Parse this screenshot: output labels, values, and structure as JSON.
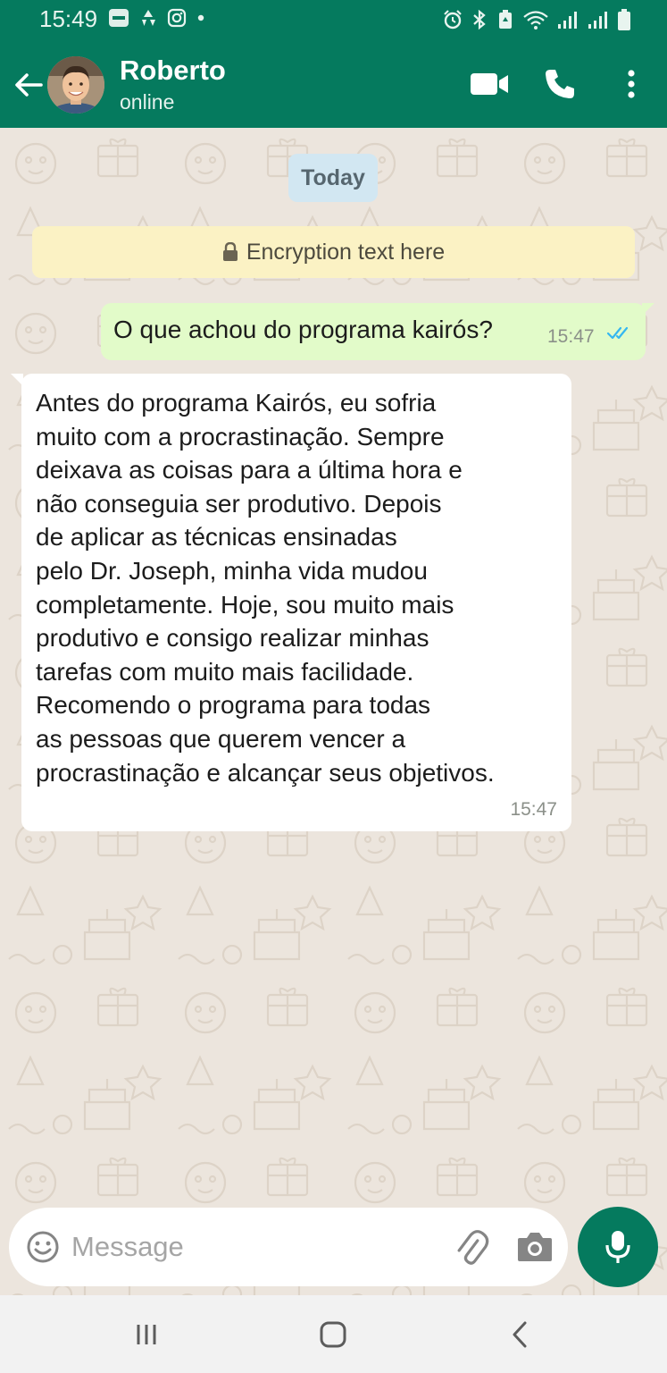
{
  "status_bar": {
    "time": "15:49",
    "left_icons": [
      "inter-app-icon",
      "recycle-icon",
      "instagram-icon",
      "dot-icon"
    ],
    "right_icons": [
      "alarm-icon",
      "bluetooth-icon",
      "battery-saver-icon",
      "wifi-icon",
      "signal-icon",
      "signal-icon",
      "battery-icon"
    ]
  },
  "header": {
    "contact_name": "Roberto",
    "contact_status": "online",
    "actions": [
      "video-call-icon",
      "phone-icon",
      "more-vert-icon"
    ]
  },
  "chat": {
    "date_chip": "Today",
    "encryption_text": "Encryption text here",
    "messages": [
      {
        "direction": "outgoing",
        "text": "O que achou do programa kairós?",
        "time": "15:47",
        "status": "read",
        "status_color": "#34b7f1"
      },
      {
        "direction": "incoming",
        "text": "Antes do programa Kairós, eu sofria\nmuito com a procrastinação. Sempre\ndeixava as coisas para a última hora e\nnão conseguia ser produtivo. Depois\nde aplicar as técnicas ensinadas\npelo Dr. Joseph, minha vida mudou\ncompletamente. Hoje, sou muito mais\nprodutivo e consigo realizar minhas\ntarefas com muito mais facilidade.\nRecomendo o programa para todas\nas pessoas que querem vencer a\nprocrastinação e alcançar seus objetivos.",
        "time": "15:47"
      }
    ]
  },
  "composer": {
    "placeholder": "Message",
    "value": ""
  },
  "colors": {
    "brand": "#057a5e",
    "outgoing_bubble": "#e2fbc9",
    "incoming_bubble": "#ffffff",
    "chat_background": "#ece5dd",
    "read_ticks": "#34b7f1"
  },
  "nav_bar": {
    "buttons": [
      "recent-apps-icon",
      "home-icon",
      "back-icon"
    ]
  }
}
